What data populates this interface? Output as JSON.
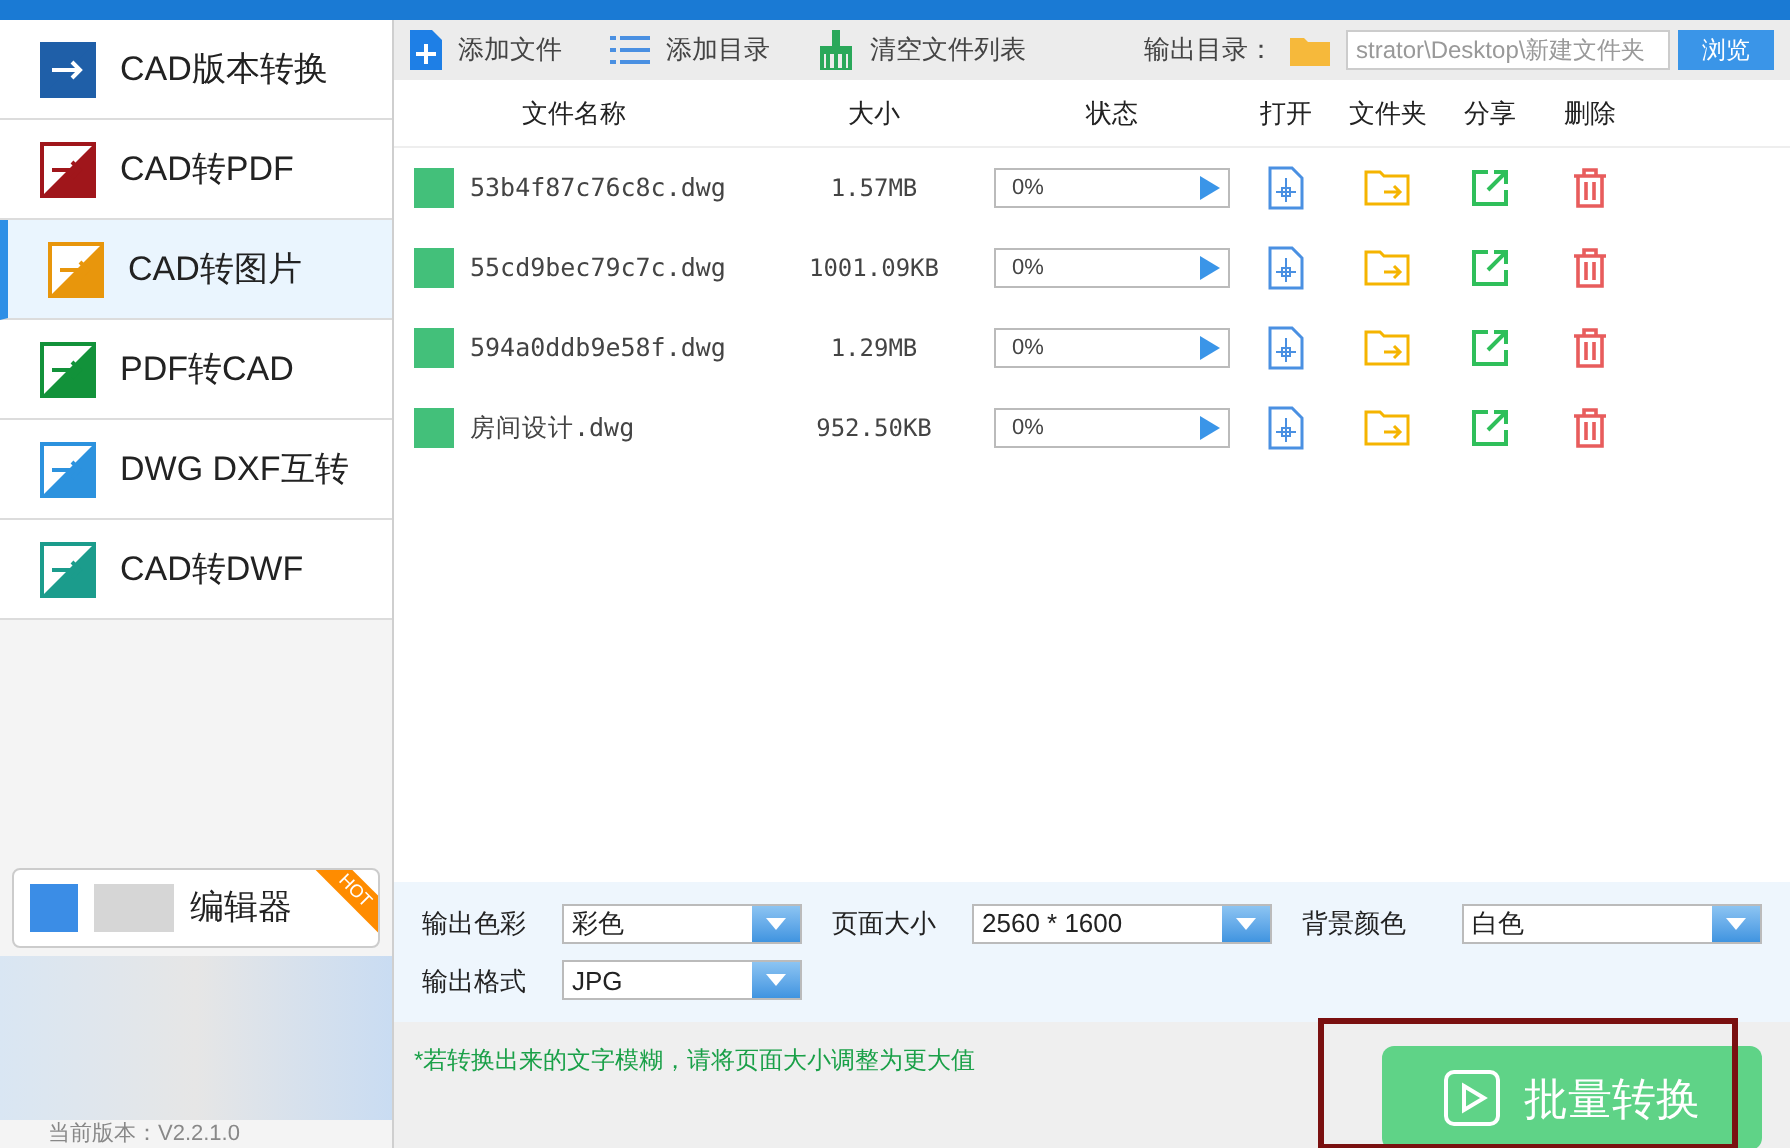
{
  "sidebar": {
    "items": [
      {
        "label": "CAD版本转换",
        "kind": "version",
        "selected": false
      },
      {
        "label": "CAD转PDF",
        "kind": "pdf",
        "selected": false
      },
      {
        "label": "CAD转图片",
        "kind": "image",
        "selected": true
      },
      {
        "label": "PDF转CAD",
        "kind": "pdf2cad",
        "selected": false
      },
      {
        "label": "DWG DXF互转",
        "kind": "dxf",
        "selected": false
      },
      {
        "label": "CAD转DWF",
        "kind": "dwf",
        "selected": false
      }
    ],
    "promo": {
      "label": "编辑器",
      "badge": "HOT"
    },
    "version": "当前版本：V2.2.1.0"
  },
  "toolbar": {
    "add_file": "添加文件",
    "add_folder": "添加目录",
    "clear_list": "清空文件列表",
    "output_label": "输出目录：",
    "output_path": "strator\\Desktop\\新建文件夹",
    "browse": "浏览"
  },
  "table": {
    "columns": [
      "文件名称",
      "大小",
      "状态",
      "打开",
      "文件夹",
      "分享",
      "删除"
    ],
    "rows": [
      {
        "name": "53b4f87c76c8c.dwg",
        "size": "1.57MB",
        "progress": "0%",
        "level": 0
      },
      {
        "name": "55cd9bec79c7c.dwg",
        "size": "1001.09KB",
        "progress": "0%",
        "level": 0
      },
      {
        "name": "594a0ddb9e58f.dwg",
        "size": "1.29MB",
        "progress": "0%",
        "level": 0
      },
      {
        "name": "房间设计.dwg",
        "size": "952.50KB",
        "progress": "0%",
        "level": 0
      }
    ]
  },
  "settings": [
    {
      "label": "输出色彩",
      "value": "彩色"
    },
    {
      "label": "页面大小",
      "value": "2560 * 1600"
    },
    {
      "label": "背景颜色",
      "value": "白色"
    },
    {
      "label": "输出格式",
      "value": "JPG"
    }
  ],
  "note": "*若转换出来的文字模糊，请将页面大小调整为更大值",
  "convert_button": "批量转换"
}
